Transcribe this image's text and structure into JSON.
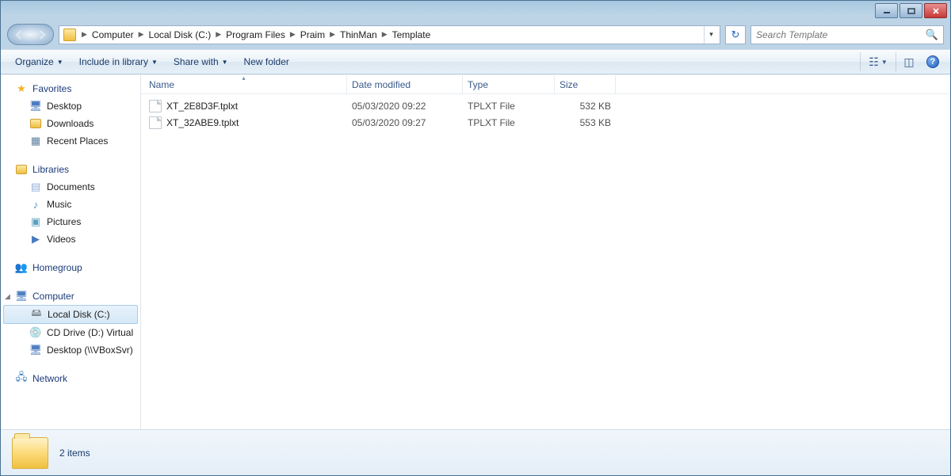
{
  "breadcrumbs": [
    "Computer",
    "Local Disk (C:)",
    "Program Files",
    "Praim",
    "ThinMan",
    "Template"
  ],
  "search_placeholder": "Search Template",
  "toolbar": {
    "organize": "Organize",
    "include": "Include in library",
    "share": "Share with",
    "newfolder": "New folder"
  },
  "nav": {
    "favorites": {
      "label": "Favorites",
      "items": [
        "Desktop",
        "Downloads",
        "Recent Places"
      ]
    },
    "libraries": {
      "label": "Libraries",
      "items": [
        "Documents",
        "Music",
        "Pictures",
        "Videos"
      ]
    },
    "homegroup": {
      "label": "Homegroup"
    },
    "computer": {
      "label": "Computer",
      "items": [
        "Local Disk (C:)",
        "CD Drive (D:) Virtual",
        "Desktop (\\\\VBoxSvr)"
      ]
    },
    "network": {
      "label": "Network"
    }
  },
  "columns": {
    "name": "Name",
    "date": "Date modified",
    "type": "Type",
    "size": "Size"
  },
  "files": [
    {
      "name": "XT_2E8D3F.tplxt",
      "date": "05/03/2020 09:22",
      "type": "TPLXT File",
      "size": "532 KB"
    },
    {
      "name": "XT_32ABE9.tplxt",
      "date": "05/03/2020 09:27",
      "type": "TPLXT File",
      "size": "553 KB"
    }
  ],
  "details": {
    "summary": "2 items"
  }
}
